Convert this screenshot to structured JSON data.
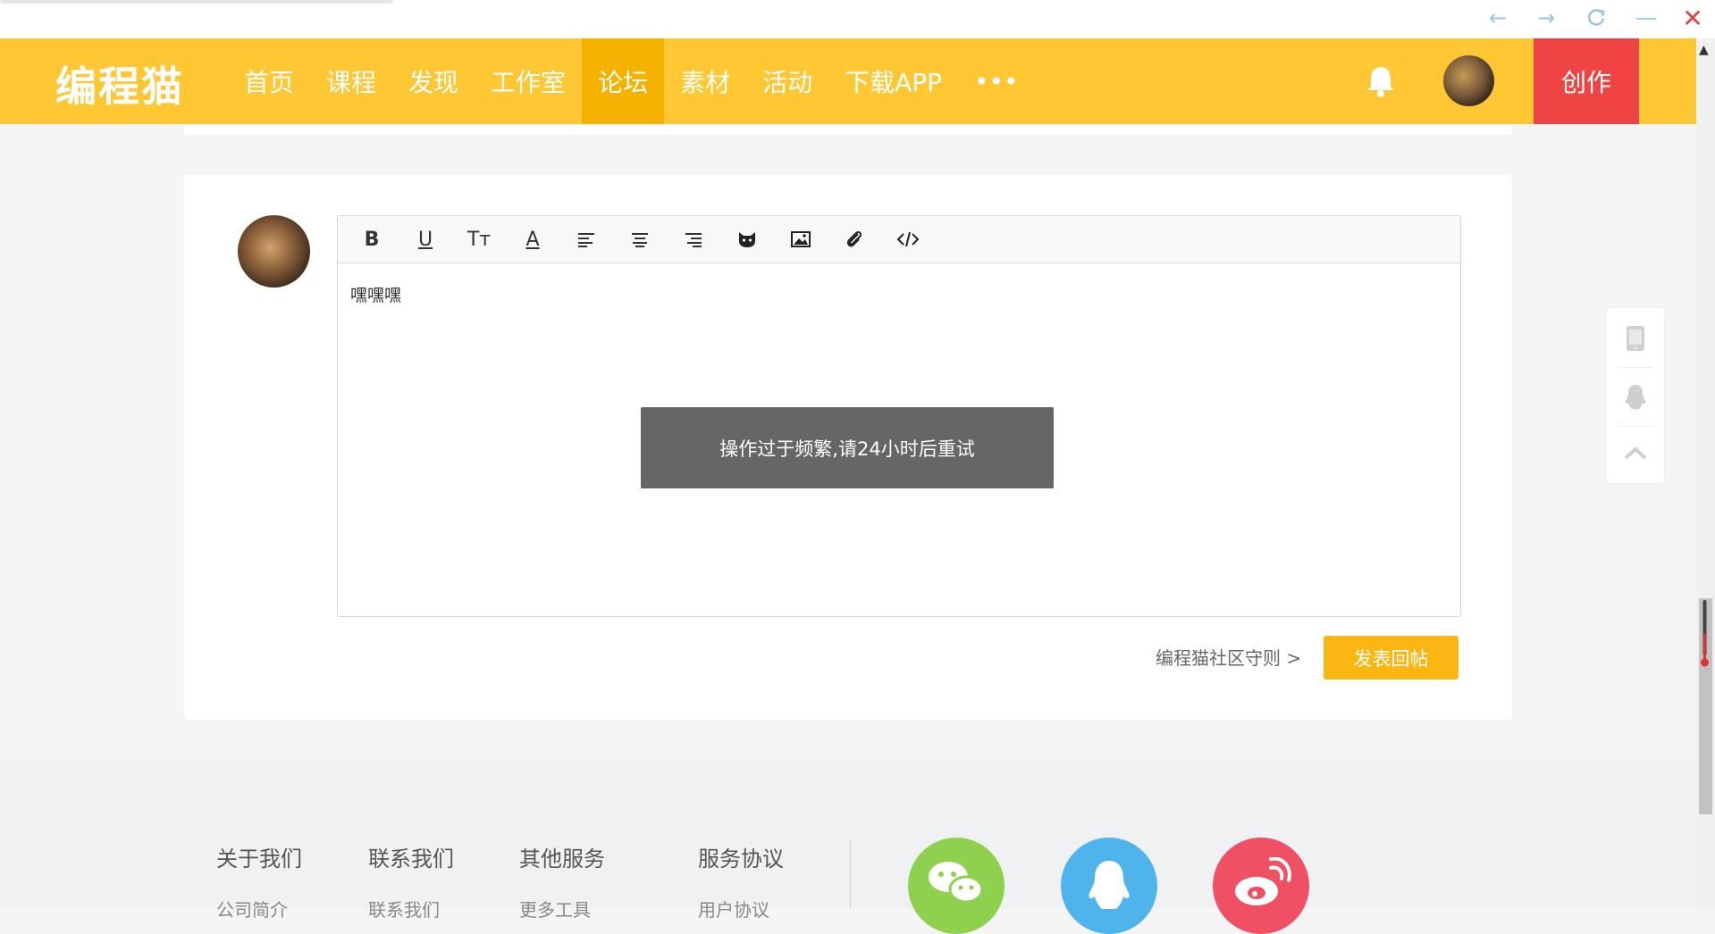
{
  "window": {
    "controls": [
      "back-icon",
      "forward-icon",
      "refresh-icon",
      "minimize-icon",
      "close-icon"
    ]
  },
  "header": {
    "logo": "编程猫",
    "nav": [
      {
        "label": "首页",
        "active": false
      },
      {
        "label": "课程",
        "active": false
      },
      {
        "label": "发现",
        "active": false
      },
      {
        "label": "工作室",
        "active": false
      },
      {
        "label": "论坛",
        "active": true
      },
      {
        "label": "素材",
        "active": false
      },
      {
        "label": "活动",
        "active": false
      },
      {
        "label": "下载APP",
        "active": false
      },
      {
        "label": "•••",
        "active": false
      }
    ],
    "create_label": "创作",
    "colors": {
      "bar": "#ffc733",
      "active": "#f5b200",
      "create": "#ef4444"
    }
  },
  "editor": {
    "toolbar": [
      "bold",
      "underline",
      "font-size",
      "font-color",
      "align-left",
      "align-center",
      "align-right",
      "emoji",
      "image",
      "attachment",
      "code"
    ],
    "toolbar_glyphs": {
      "bold": "B",
      "underline": "U",
      "font-size": "Tт",
      "font-color": "A"
    },
    "content": "嘿嘿嘿"
  },
  "toast": {
    "message": "操作过于频繁,请24小时后重试"
  },
  "actions": {
    "rules_link": "编程猫社区守则 >",
    "submit_label": "发表回帖",
    "submit_color": "#fbb614"
  },
  "float_panel": [
    "tablet-icon",
    "qq-icon",
    "back-to-top-icon"
  ],
  "footer": {
    "columns": [
      {
        "title": "关于我们",
        "first_item": "公司简介"
      },
      {
        "title": "联系我们",
        "first_item": "联系我们"
      },
      {
        "title": "其他服务",
        "first_item": "更多工具"
      },
      {
        "title": "服务协议",
        "first_item": "用户协议"
      }
    ],
    "social": [
      {
        "icon": "wechat-icon",
        "color": "#8fd14f"
      },
      {
        "icon": "qq-icon",
        "color": "#4fb3ec"
      },
      {
        "icon": "weibo-icon",
        "color": "#ef5064"
      }
    ]
  }
}
